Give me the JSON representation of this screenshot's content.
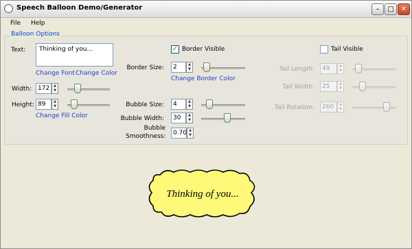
{
  "window": {
    "title": "Speech Balloon Demo/Generator",
    "icon": "speech-balloon-icon"
  },
  "menu": [
    "File",
    "Help"
  ],
  "group": {
    "title": "Balloon Options"
  },
  "text": {
    "label": "Text:",
    "value": "Thinking of you..."
  },
  "links": {
    "change_font": "Change Font",
    "change_color": "Change Color",
    "change_fill": "Change Fill Color",
    "change_border": "Change Border Color"
  },
  "width": {
    "label": "Width:",
    "value": "172"
  },
  "height": {
    "label": "Height:",
    "value": "89"
  },
  "border_visible": {
    "label": "Border Visible",
    "checked": true
  },
  "border_size": {
    "label": "Border Size:",
    "value": "2"
  },
  "bubble_size": {
    "label": "Bubble Size:",
    "value": "4"
  },
  "bubble_width": {
    "label": "Bubble Width:",
    "value": "30"
  },
  "bubble_smoothness": {
    "label_line1": "Bubble",
    "label_line2": "Smoothness:",
    "value": "0.70"
  },
  "tail_visible": {
    "label": "Tail Visible",
    "checked": false
  },
  "tail_length": {
    "label": "Tail Length:",
    "value": "49"
  },
  "tail_width": {
    "label": "Tail Width:",
    "value": "25"
  },
  "tail_rotation": {
    "label": "Tail Rotation:",
    "value": "260"
  },
  "preview": {
    "text": "Thinking of you...",
    "fill": "#fff97a",
    "border": "#000000"
  }
}
